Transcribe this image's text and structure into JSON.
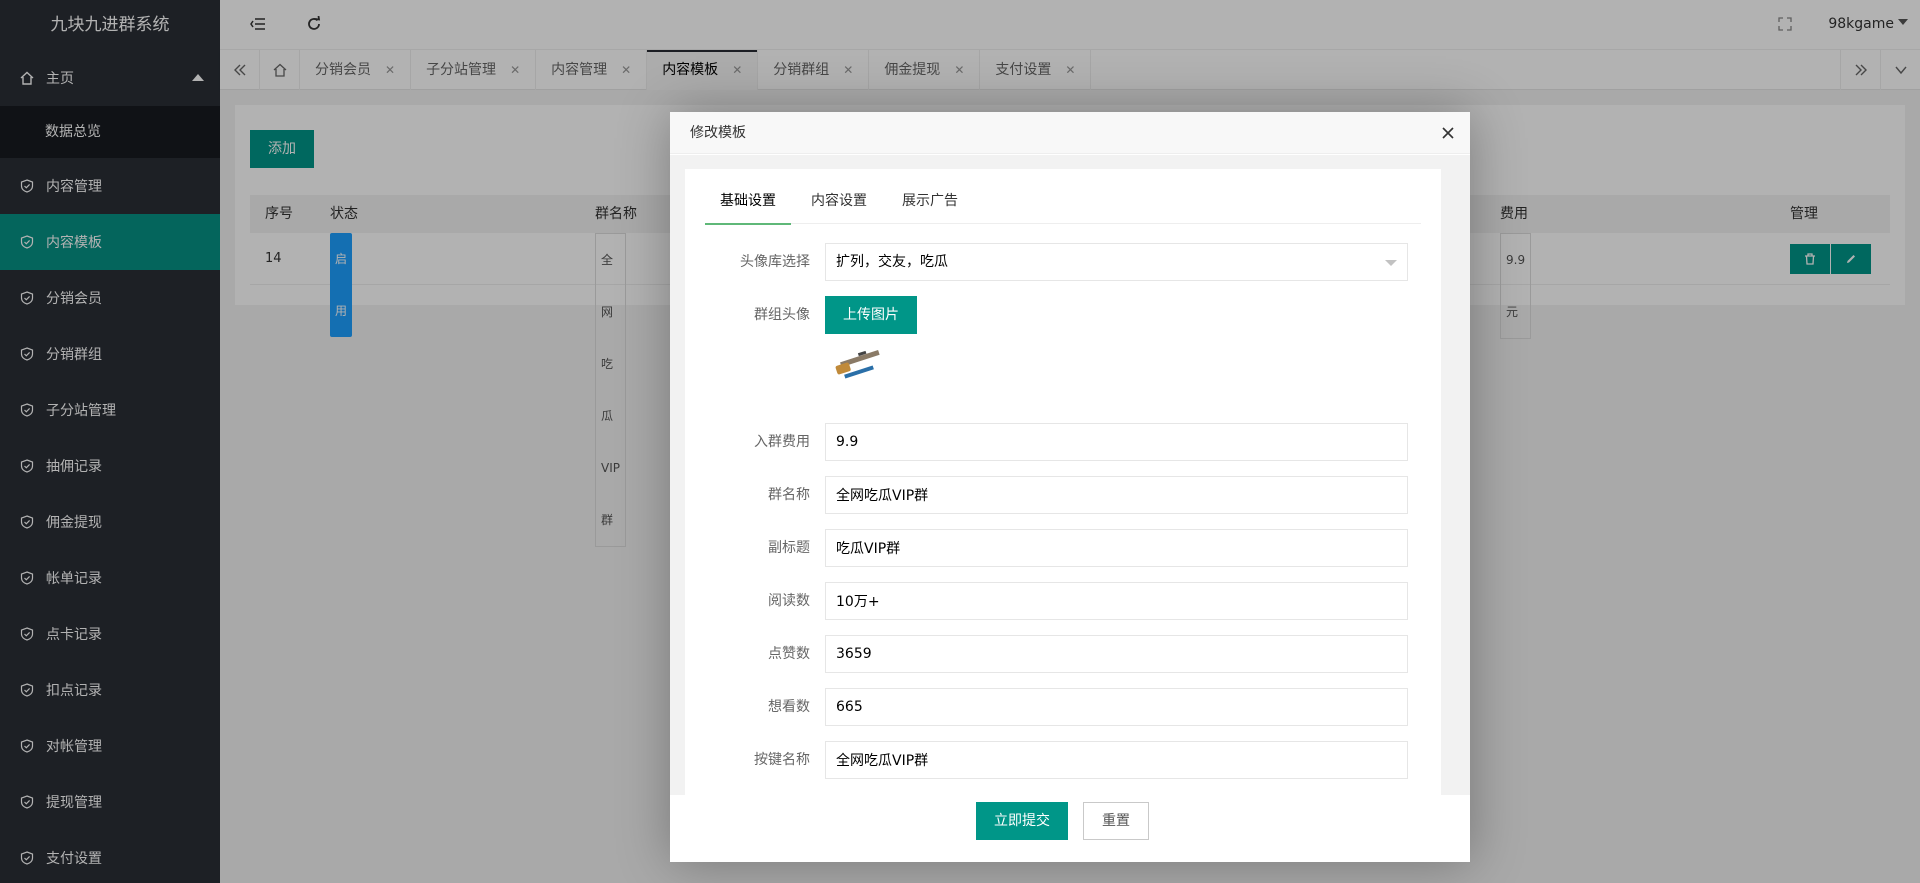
{
  "app": {
    "title": "九块九进群系统"
  },
  "sidebar": {
    "home_label": "主页",
    "home_sub": "数据总览",
    "items": [
      {
        "label": "内容管理"
      },
      {
        "label": "内容模板"
      },
      {
        "label": "分销会员"
      },
      {
        "label": "分销群组"
      },
      {
        "label": "子分站管理"
      },
      {
        "label": "抽佣记录"
      },
      {
        "label": "佣金提现"
      },
      {
        "label": "帐单记录"
      },
      {
        "label": "点卡记录"
      },
      {
        "label": "扣点记录"
      },
      {
        "label": "对帐管理"
      },
      {
        "label": "提现管理"
      },
      {
        "label": "支付设置"
      }
    ]
  },
  "header": {
    "user": "98kgame"
  },
  "tabs": [
    {
      "label": "分销会员"
    },
    {
      "label": "子分站管理"
    },
    {
      "label": "内容管理"
    },
    {
      "label": "内容模板"
    },
    {
      "label": "分销群组"
    },
    {
      "label": "佣金提现"
    },
    {
      "label": "支付设置"
    }
  ],
  "page": {
    "add_label": "添加",
    "columns": {
      "seq": "序号",
      "status": "状态",
      "group_name": "群名称",
      "fee": "费用",
      "manage": "管理"
    },
    "row": {
      "seq": "14",
      "status": "启用",
      "group_name": "全网吃瓜VIP群",
      "fee": "9.9 元"
    }
  },
  "modal": {
    "title": "修改模板",
    "tabs": [
      "基础设置",
      "内容设置",
      "展示广告"
    ],
    "fields": {
      "avatar_lib_label": "头像库选择",
      "avatar_lib_value": "扩列，交友，吃瓜",
      "group_avatar_label": "群组头像",
      "upload_label": "上传图片",
      "fee_label": "入群费用",
      "fee_value": "9.9",
      "name_label": "群名称",
      "name_value": "全网吃瓜VIP群",
      "subtitle_label": "副标题",
      "subtitle_value": "吃瓜VIP群",
      "reads_label": "阅读数",
      "reads_value": "10万+",
      "likes_label": "点赞数",
      "likes_value": "3659",
      "wants_label": "想看数",
      "wants_value": "665",
      "button_label": "按键名称",
      "button_value": "全网吃瓜VIP群"
    },
    "submit_label": "立即提交",
    "reset_label": "重置"
  },
  "colors": {
    "accent": "#009688",
    "sidebar": "#2a2e36",
    "active_nav": "#079185"
  }
}
